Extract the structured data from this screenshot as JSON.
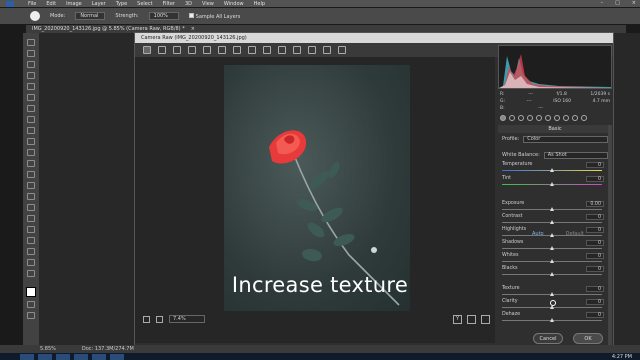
{
  "menubar": {
    "items": [
      "File",
      "Edit",
      "Image",
      "Layer",
      "Type",
      "Select",
      "Filter",
      "3D",
      "View",
      "Window",
      "Help"
    ]
  },
  "options_bar": {
    "mode_label": "Mode:",
    "mode_value": "Normal",
    "strength_label": "Strength:",
    "strength_value": "100%",
    "sample_all_layers": "Sample All Layers"
  },
  "document_tab": {
    "title": "IMG_20200920_143126.jpg @ 5.85% (Camera Raw, RGB/8) *",
    "close": "×"
  },
  "status_bar": {
    "zoom": "5.85%",
    "doc": "Doc: 137.3M/274.7M"
  },
  "camera_raw": {
    "title": "Camera Raw (IMG_20200920_143126.jpg)",
    "zoom_value": "7.4%",
    "readout": {
      "r_label": "R:",
      "r_value": "---",
      "g_label": "G:",
      "g_value": "---",
      "b_label": "B:",
      "b_value": "---",
      "aperture": "f/1.8",
      "shutter": "1/2039 s",
      "iso": "ISO 160",
      "focal": "4.7 mm"
    },
    "panel_title": "Basic",
    "profile_label": "Profile:",
    "profile_value": "Color",
    "white_balance_label": "White Balance:",
    "white_balance_value": "As Shot",
    "auto_label": "Auto",
    "default_label": "Default",
    "sliders": [
      {
        "label": "Temperature",
        "value": "0",
        "pct": 0.5
      },
      {
        "label": "Tint",
        "value": "0",
        "pct": 0.5
      },
      {
        "label": "Exposure",
        "value": "0.00",
        "pct": 0.5
      },
      {
        "label": "Contrast",
        "value": "0",
        "pct": 0.5
      },
      {
        "label": "Highlights",
        "value": "0",
        "pct": 0.5
      },
      {
        "label": "Shadows",
        "value": "0",
        "pct": 0.5
      },
      {
        "label": "Whites",
        "value": "0",
        "pct": 0.5
      },
      {
        "label": "Blacks",
        "value": "0",
        "pct": 0.5
      },
      {
        "label": "Texture",
        "value": "0",
        "pct": 0.5
      },
      {
        "label": "Clarity",
        "value": "0",
        "pct": 0.5
      },
      {
        "label": "Dehaze",
        "value": "0",
        "pct": 0.5
      }
    ],
    "cancel_label": "Cancel",
    "ok_label": "OK"
  },
  "caption": "Increase texture",
  "taskbar": {
    "clock": "4:27 PM"
  }
}
